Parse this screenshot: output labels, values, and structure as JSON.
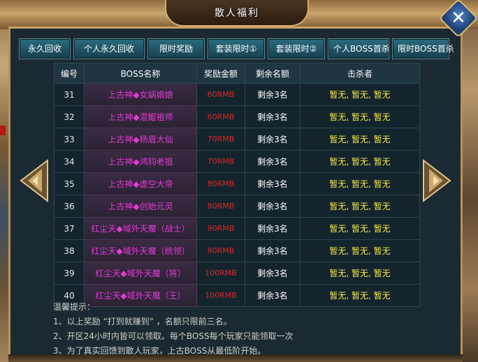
{
  "window": {
    "title": "散人福利",
    "close_icon": "close-x-icon"
  },
  "tabs": [
    {
      "label": "永久回收"
    },
    {
      "label": "个人永久回收"
    },
    {
      "label": "限时奖励"
    },
    {
      "label": "套装限时①"
    },
    {
      "label": "套装限时②"
    },
    {
      "label": "个人BOSS首杀"
    },
    {
      "label": "限时BOSS首杀"
    }
  ],
  "table": {
    "headers": [
      "编号",
      "BOSS名称",
      "奖励金额",
      "剩余名额",
      "击杀者"
    ],
    "rows": [
      {
        "num": "31",
        "name": "上古神◆女娲娘娘",
        "reward": "60RMB",
        "remain": "剩余3名",
        "killer": "暂无, 暂无, 暂无",
        "name_color": "#e23bd6"
      },
      {
        "num": "32",
        "name": "上古神◆混鲲祖师",
        "reward": "60RMB",
        "remain": "剩余3名",
        "killer": "暂无, 暂无, 暂无",
        "name_color": "#e23bd6"
      },
      {
        "num": "33",
        "name": "上古神◆杨眉大仙",
        "reward": "70RMB",
        "remain": "剩余3名",
        "killer": "暂无, 暂无, 暂无",
        "name_color": "#e23bd6"
      },
      {
        "num": "34",
        "name": "上古神◆鸿钧老祖",
        "reward": "70RMB",
        "remain": "剩余3名",
        "killer": "暂无, 暂无, 暂无",
        "name_color": "#e23bd6"
      },
      {
        "num": "35",
        "name": "上古神◆虚空大帝",
        "reward": "80RMB",
        "remain": "剩余3名",
        "killer": "暂无, 暂无, 暂无",
        "name_color": "#e23bd6"
      },
      {
        "num": "36",
        "name": "上古神◆创始元灵",
        "reward": "80RMB",
        "remain": "剩余3名",
        "killer": "暂无, 暂无, 暂无",
        "name_color": "#e23bd6"
      },
      {
        "num": "37",
        "name": "红尘天◆域外天魔（战士）",
        "reward": "90RMB",
        "remain": "剩余3名",
        "killer": "暂无, 暂无, 暂无",
        "name_color": "#e23bd6"
      },
      {
        "num": "38",
        "name": "红尘天◆域外天魔（统领）",
        "reward": "90RMB",
        "remain": "剩余3名",
        "killer": "暂无, 暂无, 暂无",
        "name_color": "#e23bd6"
      },
      {
        "num": "39",
        "name": "红尘天◆域外天魔（将）",
        "reward": "100RMB",
        "remain": "剩余3名",
        "killer": "暂无, 暂无, 暂无",
        "name_color": "#e23bd6"
      },
      {
        "num": "40",
        "name": "红尘天◆域外天魔（王）",
        "reward": "100RMB",
        "remain": "剩余3名",
        "killer": "暂无, 暂无, 暂无",
        "name_color": "#e23bd6"
      }
    ]
  },
  "nav": {
    "prev_icon": "arrow-left-icon",
    "next_icon": "arrow-right-icon"
  },
  "tips": {
    "heading": "温馨提示：",
    "lines": [
      "1、以上奖励 “打到就赚到” ，名额只限前三名。",
      "2、开区24小时内皆可以领取。每个BOSS每个玩家只能领取一次",
      "3、为了真实回馈到散人玩家，上古BOSS从最低阶开始。"
    ]
  },
  "colors": {
    "reward": "#d42a2a",
    "killer": "#f3e94c",
    "boss_name": "#e23bd6",
    "frame_gold": "#c7a266"
  }
}
